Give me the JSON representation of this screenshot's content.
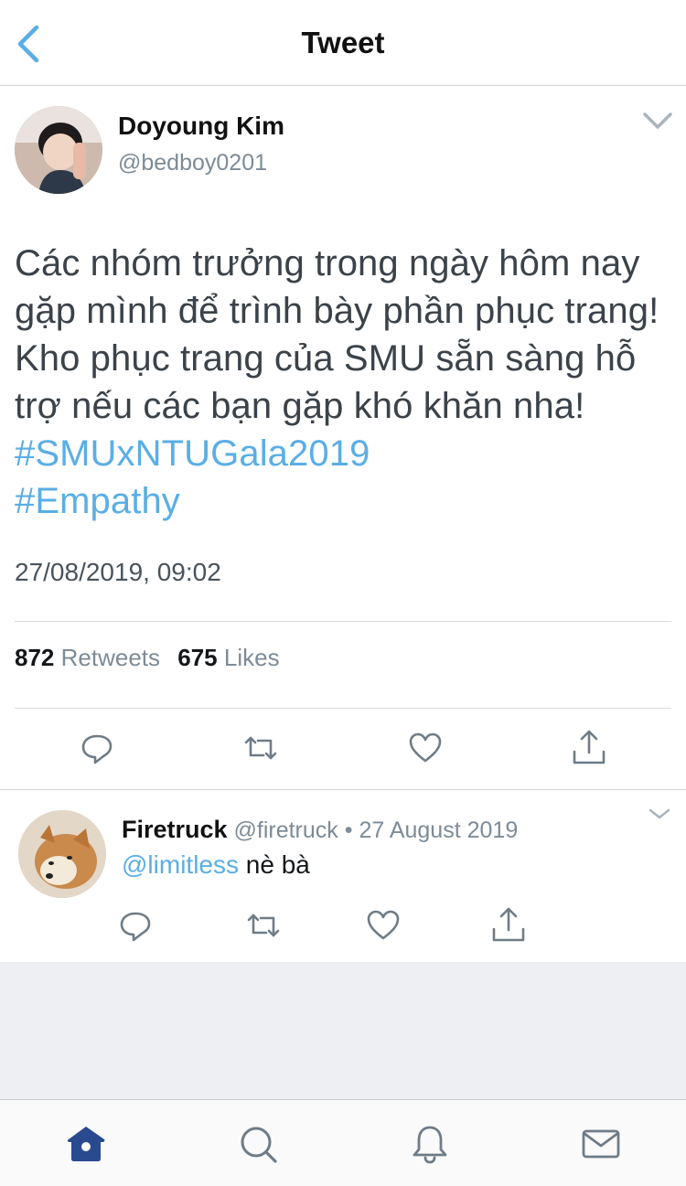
{
  "header": {
    "title": "Tweet",
    "back_icon": "chevron-left-icon"
  },
  "tweet": {
    "author_name": "Doyoung Kim",
    "author_handle": "@bedboy0201",
    "text": "Các nhóm trưởng trong ngày hôm nay gặp mình để trình bày phần phục trang! Kho phục trang của SMU sẵn sàng hỗ trợ nếu các bạn gặp khó khăn nha! ",
    "hashtags": [
      "#SMUxNTUGala2019",
      "#Empathy"
    ],
    "timestamp": "27/08/2019, 09:02",
    "retweet_count": "872",
    "retweet_label": "Retweets",
    "like_count": "675",
    "like_label": "Likes"
  },
  "reply": {
    "name": "Firetruck",
    "handle": "@firetruck",
    "separator": " • ",
    "date": "27 August 2019",
    "mention": "@limitless",
    "text": " nè bà"
  },
  "tabs": [
    {
      "icon": "home-icon",
      "active": true
    },
    {
      "icon": "search-icon",
      "active": false
    },
    {
      "icon": "bell-icon",
      "active": false
    },
    {
      "icon": "mail-icon",
      "active": false
    }
  ],
  "colors": {
    "accent": "#5aaee5",
    "active_tab": "#2a4a8f",
    "icon_gray": "#6f7c87",
    "empty_bg": "#eeeff3"
  }
}
